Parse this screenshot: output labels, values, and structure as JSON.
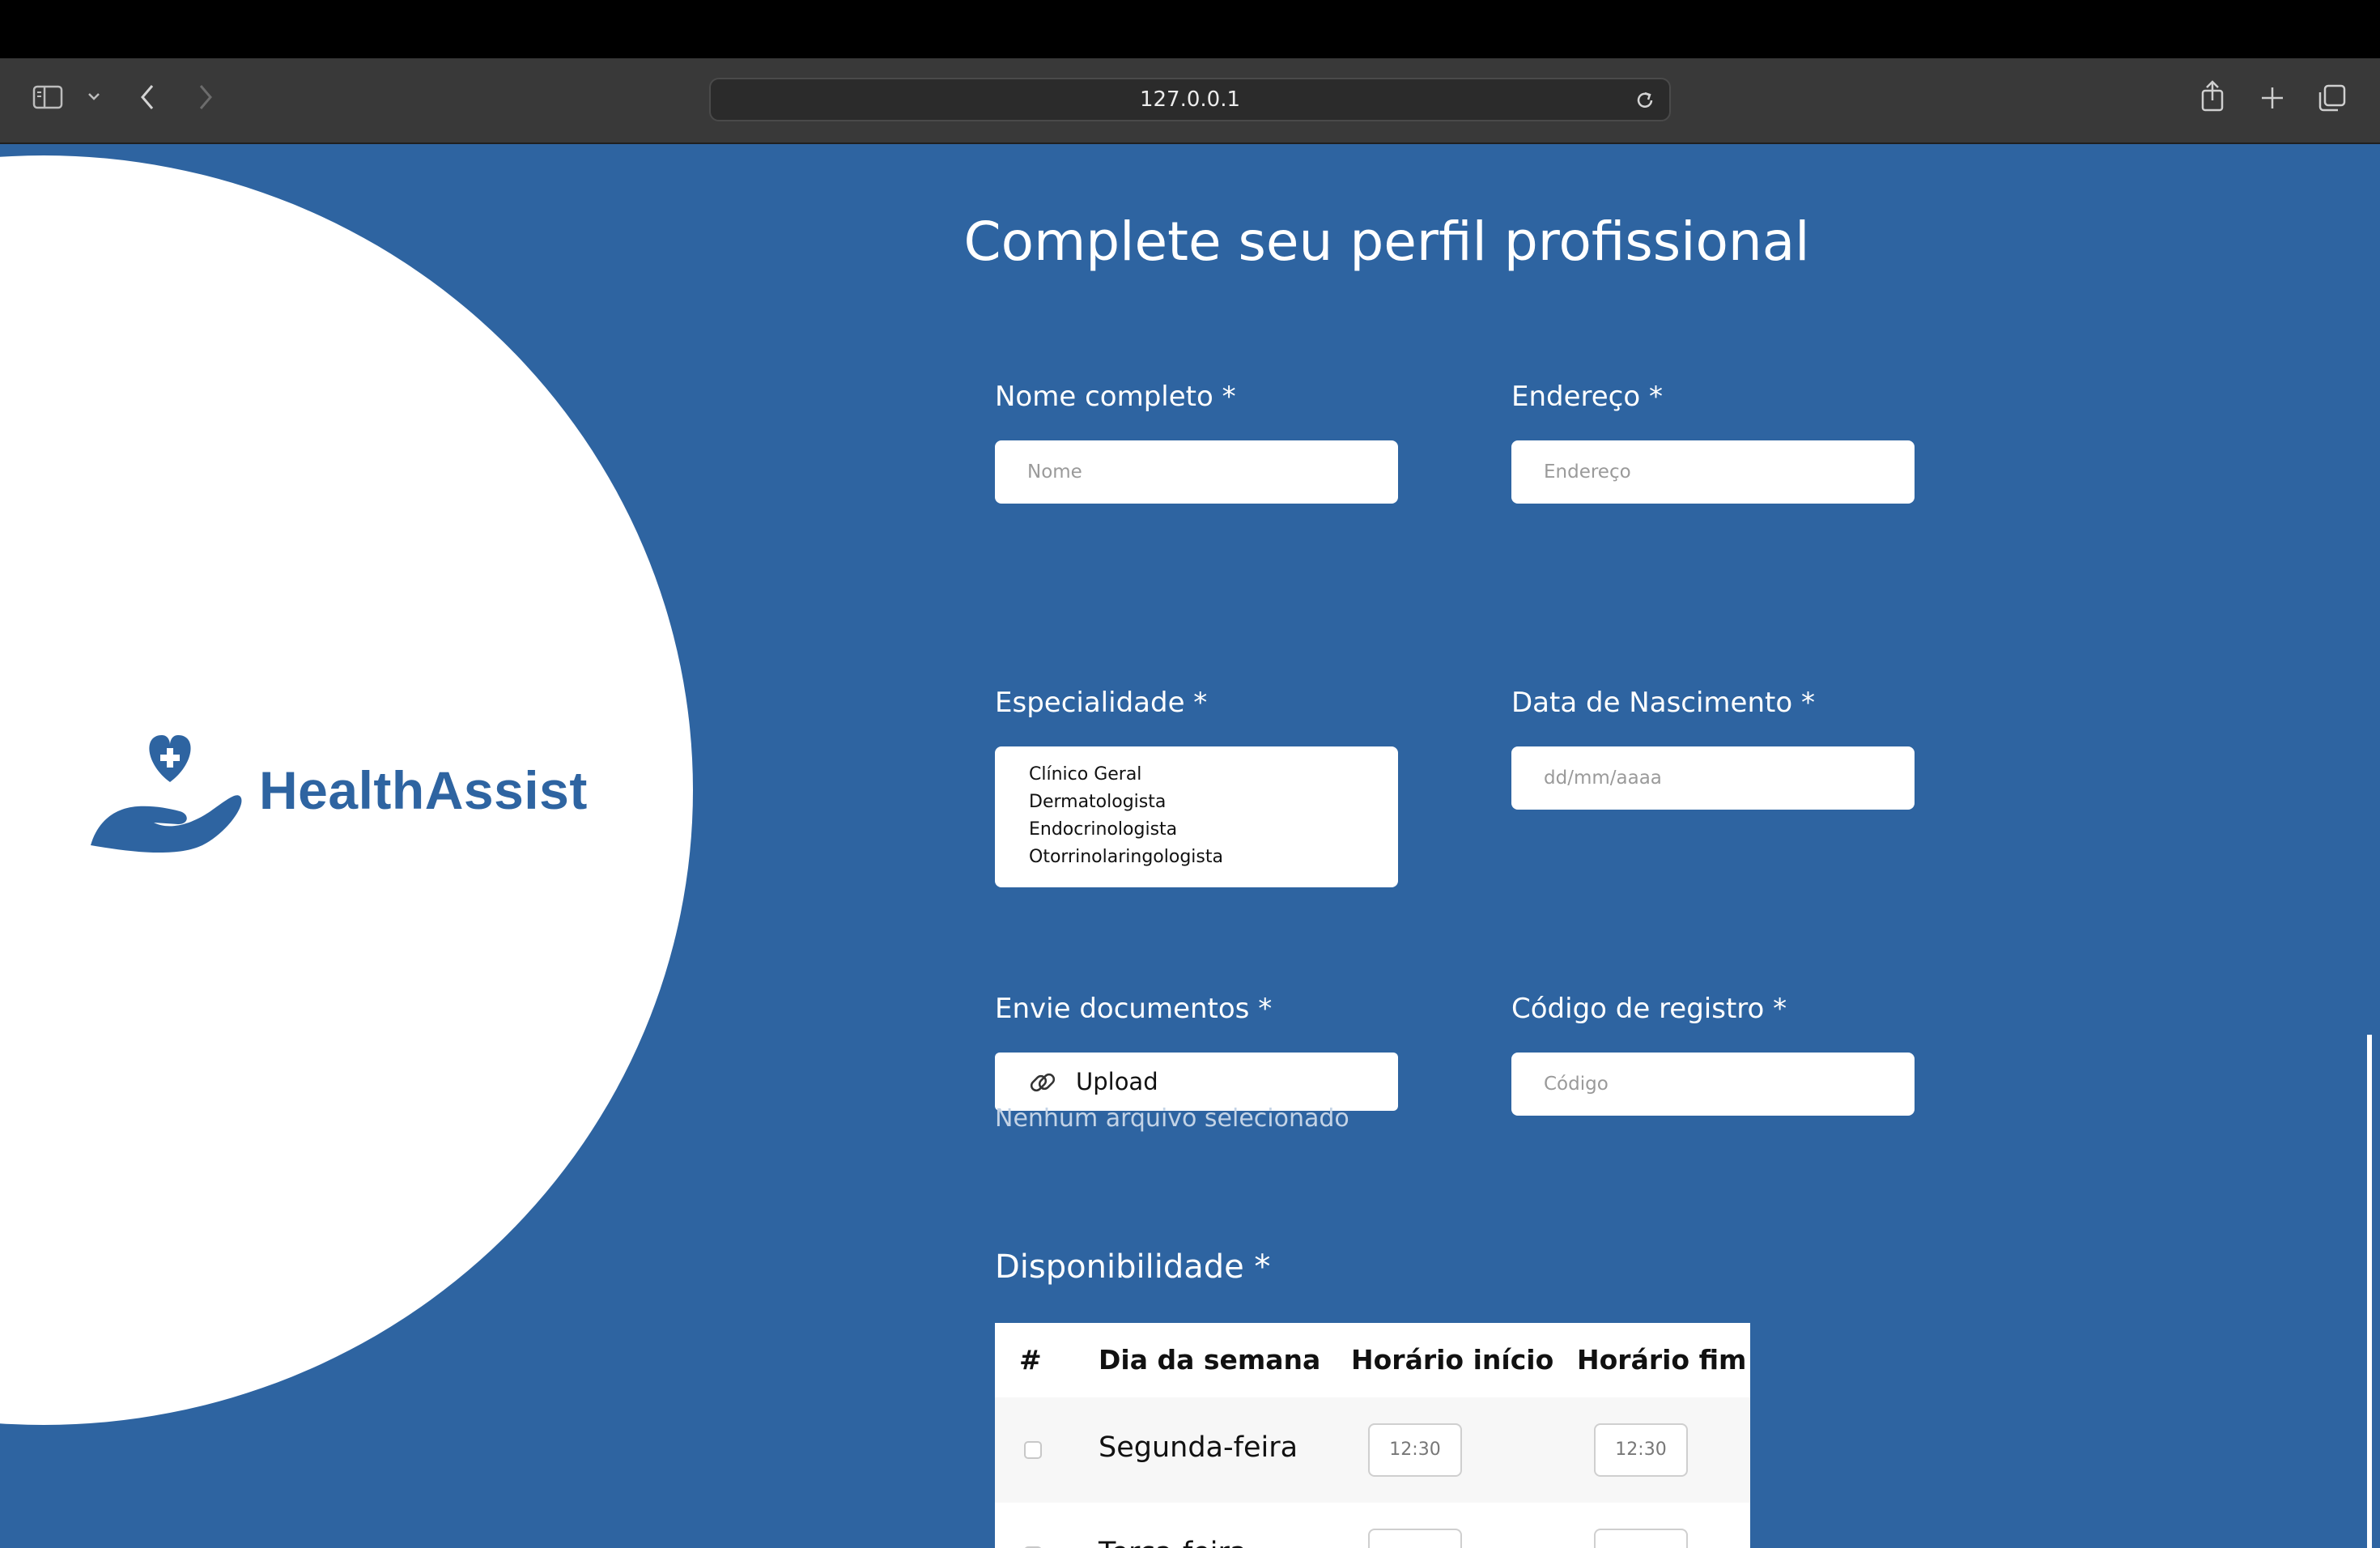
{
  "browser": {
    "url": "127.0.0.1"
  },
  "brand": {
    "name": "HealthAssist",
    "color": "#2e64a1"
  },
  "form": {
    "title": "Complete seu perfil profissional",
    "full_name": {
      "label": "Nome completo *",
      "placeholder": "Nome",
      "value": ""
    },
    "address": {
      "label": "Endereço *",
      "placeholder": "Endereço",
      "value": ""
    },
    "specialty": {
      "label": "Especialidade *",
      "options": [
        "Clínico Geral",
        "Dermatologista",
        "Endocrinologista",
        "Otorrinolaringologista"
      ]
    },
    "birth_date": {
      "label": "Data de Nascimento *",
      "placeholder": "dd/mm/aaaa",
      "value": ""
    },
    "documents": {
      "label": "Envie documentos *",
      "button": "Upload",
      "status": "Nenhum arquivo selecionado"
    },
    "registration_code": {
      "label": "Código de registro *",
      "placeholder": "Código",
      "value": ""
    }
  },
  "availability": {
    "title": "Disponibilidade *",
    "columns": [
      "#",
      "Dia da semana",
      "Horário início",
      "Horário fim"
    ],
    "rows": [
      {
        "day": "Segunda-feira",
        "start": "12:30",
        "end": "12:30",
        "checked": false
      },
      {
        "day": "Terça-feira",
        "start": "",
        "end": "",
        "checked": false
      }
    ]
  },
  "colors": {
    "page_background": "#2e64a1",
    "chrome_background": "#393939"
  }
}
